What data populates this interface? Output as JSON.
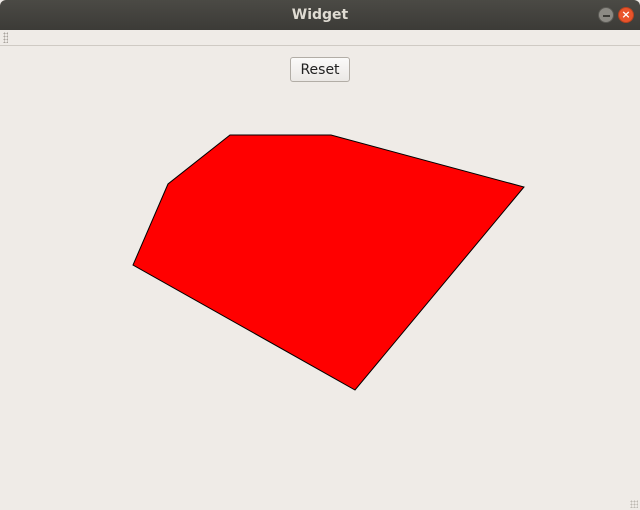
{
  "window": {
    "title": "Widget",
    "close_glyph": "×"
  },
  "toolbar": {
    "reset_label": "Reset"
  },
  "polygon": {
    "fill": "#ff0000",
    "stroke": "#000000"
  }
}
